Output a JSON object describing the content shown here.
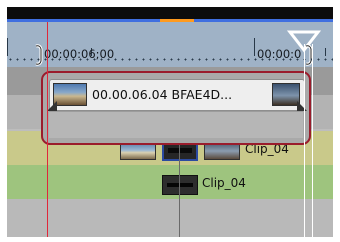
{
  "timeline": {
    "ruler": {
      "timecode_left": "00:00:06;00",
      "timecode_right": "00:00:0"
    },
    "selected_clip": {
      "title": "00.00.06.04  BFAE4D..."
    },
    "tracks": [
      {
        "clip_label": "Clip_04"
      },
      {
        "clip_label": "Clip_04"
      }
    ]
  },
  "colors": {
    "selection_border": "#9a1c2c",
    "playhead": "#e0273a",
    "bar_blue": "#3f6fe0",
    "bar_orange": "#ff9a1e",
    "ruler_bg": "#9fb2c6",
    "video_track_bg": "#c9c98a",
    "audio_track_bg": "#9ec47e"
  },
  "icons": {
    "in_marker": "bracket-marker-icon",
    "current_position": "triangle-cursor-icon"
  }
}
